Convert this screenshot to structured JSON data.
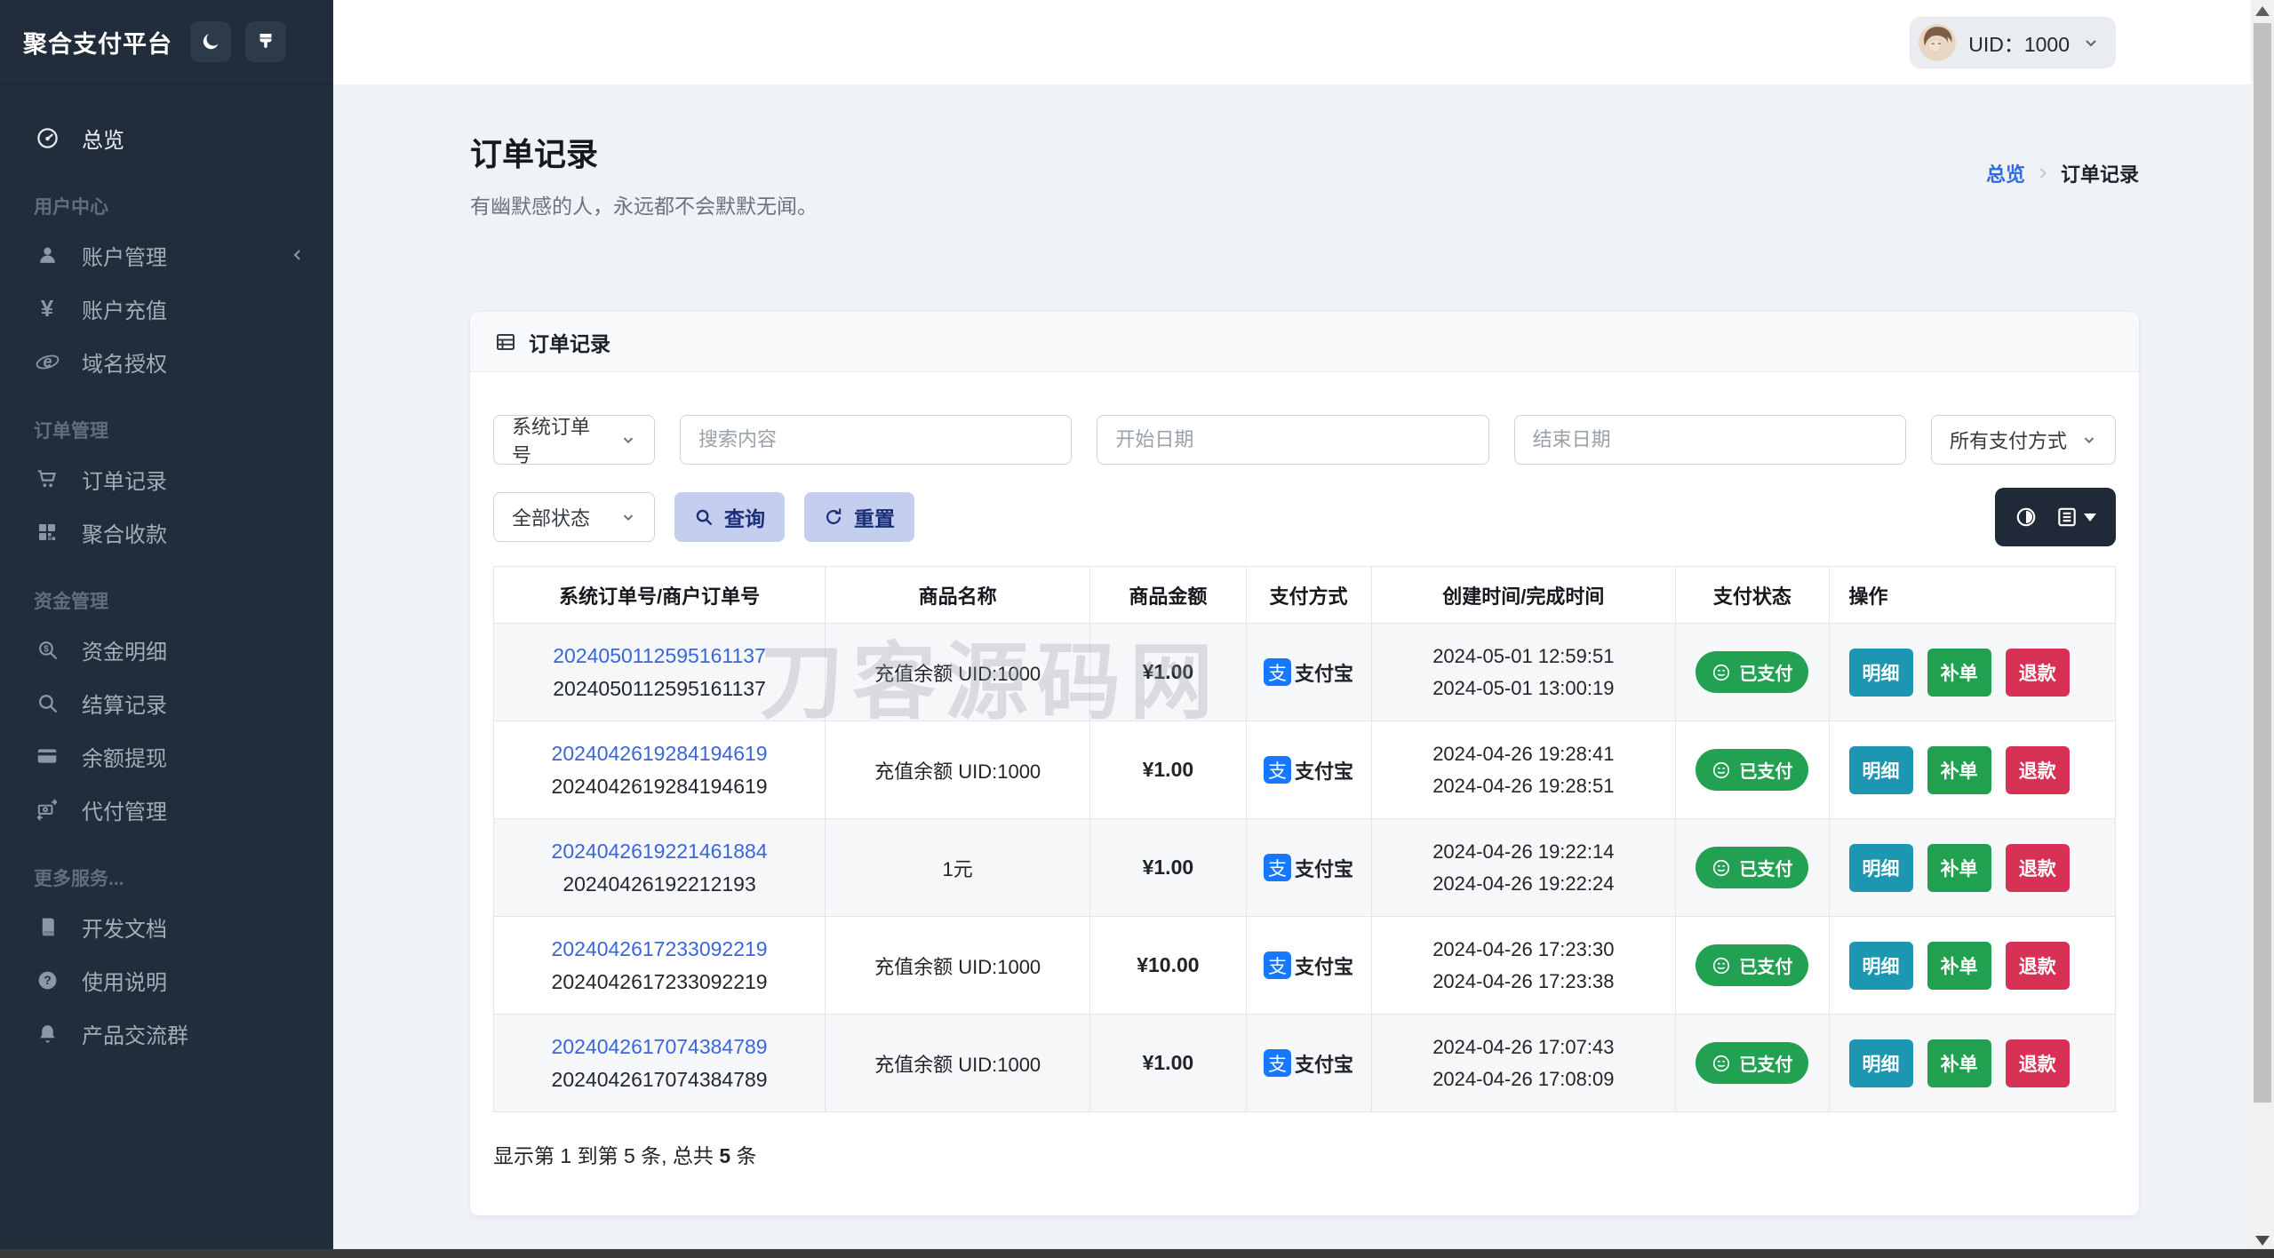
{
  "app": {
    "title": "聚合支付平台"
  },
  "topbar": {
    "uid_label": "UID：1000"
  },
  "sidebar": {
    "overview": {
      "label": "总览",
      "icon": "gauge-icon"
    },
    "sections": [
      {
        "label": "用户中心",
        "items": [
          {
            "label": "账户管理",
            "icon": "user-icon",
            "has_submenu": true
          },
          {
            "label": "账户充值",
            "icon": "yen-icon"
          },
          {
            "label": "域名授权",
            "icon": "globe-e-icon"
          }
        ]
      },
      {
        "label": "订单管理",
        "items": [
          {
            "label": "订单记录",
            "icon": "cart-icon"
          },
          {
            "label": "聚合收款",
            "icon": "qrcode-icon"
          }
        ]
      },
      {
        "label": "资金管理",
        "items": [
          {
            "label": "资金明细",
            "icon": "search-dollar-icon"
          },
          {
            "label": "结算记录",
            "icon": "search-icon"
          },
          {
            "label": "余额提现",
            "icon": "credit-card-icon"
          },
          {
            "label": "代付管理",
            "icon": "money-transfer-icon"
          }
        ]
      },
      {
        "label": "更多服务...",
        "items": [
          {
            "label": "开发文档",
            "icon": "book-icon"
          },
          {
            "label": "使用说明",
            "icon": "question-circle-icon"
          },
          {
            "label": "产品交流群",
            "icon": "bell-icon"
          }
        ]
      }
    ]
  },
  "page": {
    "title": "订单记录",
    "subtitle": "有幽默感的人，永远都不会默默无闻。",
    "breadcrumb": {
      "parent": "总览",
      "current": "订单记录"
    }
  },
  "card": {
    "header_title": "订单记录"
  },
  "filters": {
    "order_type_select": "系统订单号",
    "search_placeholder": "搜索内容",
    "start_date_placeholder": "开始日期",
    "end_date_placeholder": "结束日期",
    "pay_method_select": "所有支付方式",
    "status_select": "全部状态",
    "query_button": "查询",
    "reset_button": "重置"
  },
  "table": {
    "watermark": "刀客源码网",
    "alipay_icon_char": "支",
    "columns": [
      "系统订单号/商户订单号",
      "商品名称",
      "商品金额",
      "支付方式",
      "创建时间/完成时间",
      "支付状态",
      "操作"
    ],
    "action_labels": {
      "detail": "明细",
      "reissue": "补单",
      "refund": "退款"
    },
    "rows": [
      {
        "sys_no": "2024050112595161137",
        "merchant_no": "2024050112595161137",
        "product": "充值余额 UID:1000",
        "amount": "¥1.00",
        "pay_method": "支付宝",
        "created": "2024-05-01 12:59:51",
        "completed": "2024-05-01 13:00:19",
        "status": "已支付"
      },
      {
        "sys_no": "2024042619284194619",
        "merchant_no": "2024042619284194619",
        "product": "充值余额 UID:1000",
        "amount": "¥1.00",
        "pay_method": "支付宝",
        "created": "2024-04-26 19:28:41",
        "completed": "2024-04-26 19:28:51",
        "status": "已支付"
      },
      {
        "sys_no": "2024042619221461884",
        "merchant_no": "20240426192212193",
        "product": "1元",
        "amount": "¥1.00",
        "pay_method": "支付宝",
        "created": "2024-04-26 19:22:14",
        "completed": "2024-04-26 19:22:24",
        "status": "已支付"
      },
      {
        "sys_no": "2024042617233092219",
        "merchant_no": "2024042617233092219",
        "product": "充值余额 UID:1000",
        "amount": "¥10.00",
        "pay_method": "支付宝",
        "created": "2024-04-26 17:23:30",
        "completed": "2024-04-26 17:23:38",
        "status": "已支付"
      },
      {
        "sys_no": "2024042617074384789",
        "merchant_no": "2024042617074384789",
        "product": "充值余额 UID:1000",
        "amount": "¥1.00",
        "pay_method": "支付宝",
        "created": "2024-04-26 17:07:43",
        "completed": "2024-04-26 17:08:09",
        "status": "已支付"
      }
    ],
    "footer": {
      "prefix": "显示第 1 到第 5 条, 总共 ",
      "total": "5",
      "suffix": " 条"
    }
  },
  "colors": {
    "sidebar_bg": "#212d3b",
    "accent_blue": "#2e6be6",
    "link_blue": "#3a66db",
    "alipay_blue": "#1677ff",
    "status_green": "#23a152",
    "detail_teal": "#1d96b2",
    "reissue_green": "#21a14f",
    "refund_red": "#d83156",
    "soft_primary_bg": "#c4cff0",
    "soft_primary_text": "#1b2e78"
  }
}
